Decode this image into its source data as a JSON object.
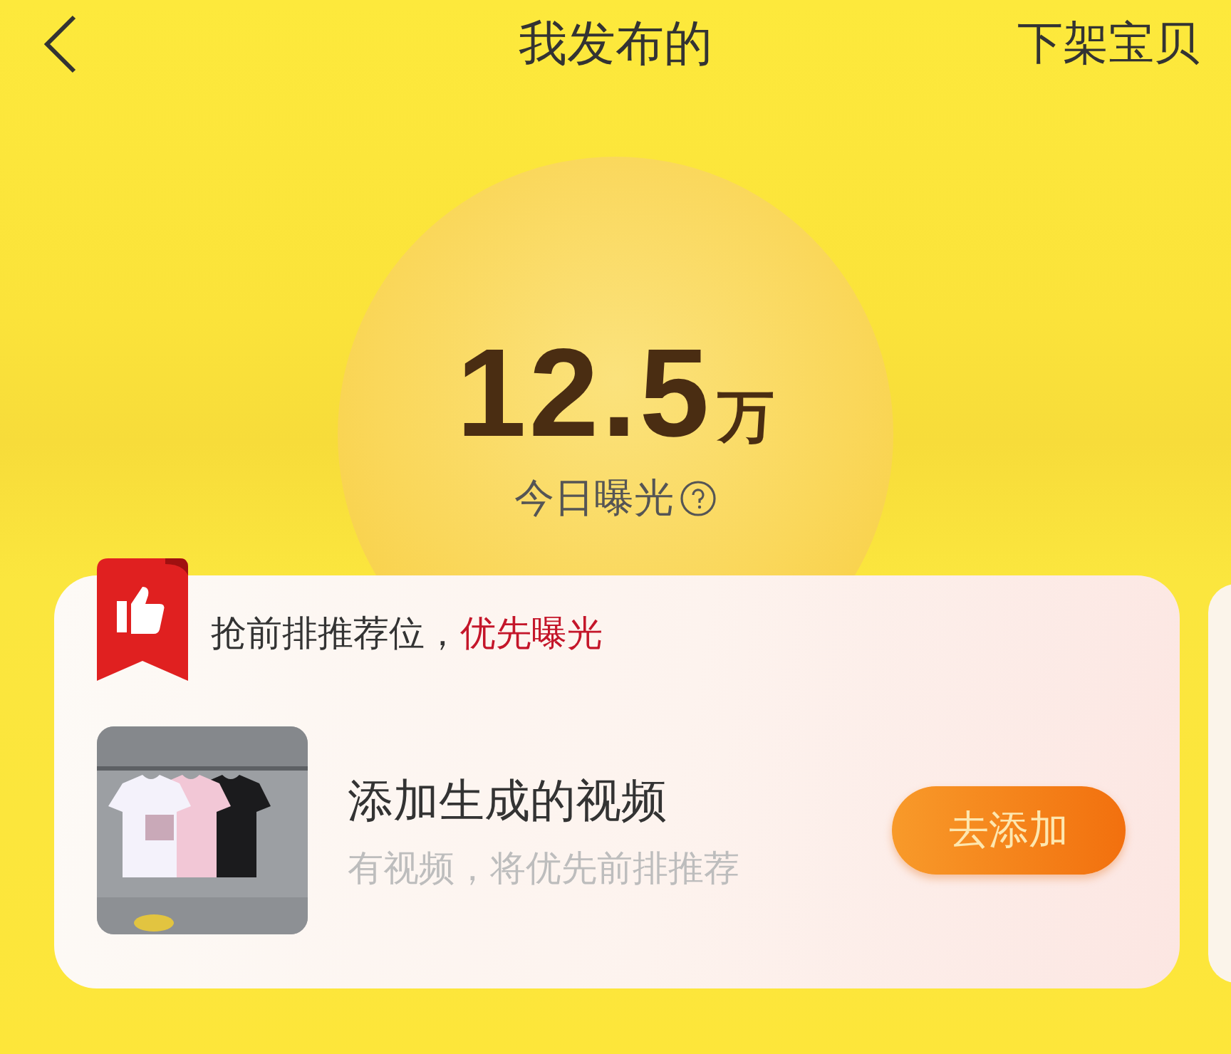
{
  "header": {
    "title": "我发布的",
    "action": "下架宝贝"
  },
  "stats": {
    "value": "12.5",
    "unit": "万",
    "label": "今日曝光"
  },
  "promo": {
    "headline": "抢前排推荐位，**优先曝光**",
    "item": {
      "title": "添加生成的视频",
      "subtitle": "有视频，将优先前排推荐",
      "button": "去添加"
    }
  }
}
